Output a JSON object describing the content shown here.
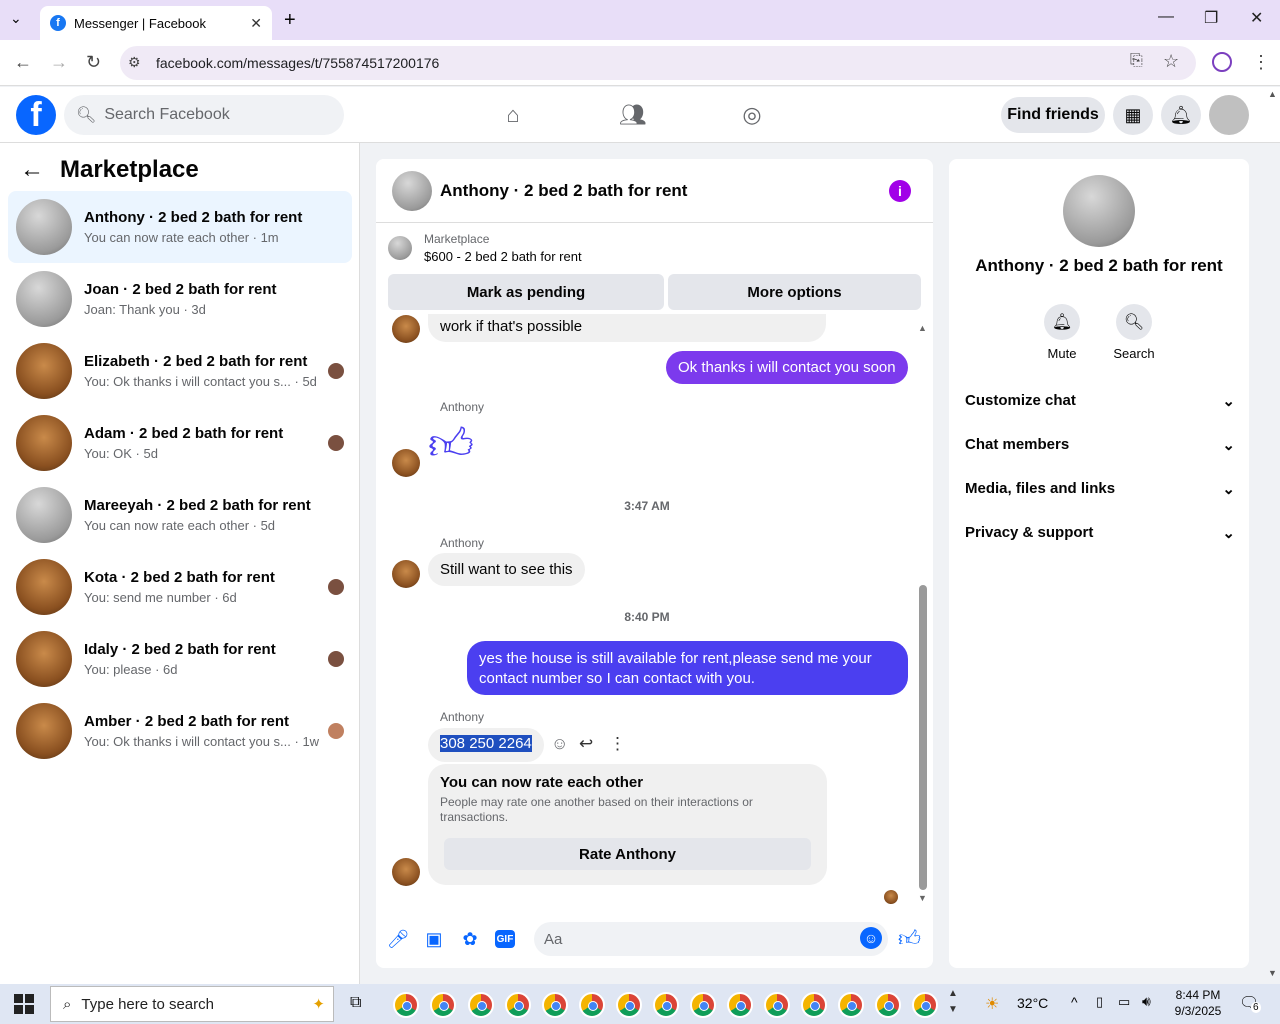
{
  "browser": {
    "tab_title": "Messenger | Facebook",
    "url": "facebook.com/messages/t/755874517200176"
  },
  "fb": {
    "search_placeholder": "Search Facebook",
    "find_friends": "Find friends"
  },
  "sidebar": {
    "title": "Marketplace",
    "conversations": [
      {
        "name": "Anthony · 2 bed 2 bath for rent",
        "preview": "You can now rate each other · 1m",
        "active": true
      },
      {
        "name": "Joan · 2 bed 2 bath for rent",
        "preview": "Joan: Thank you · 3d"
      },
      {
        "name": "Elizabeth · 2 bed 2 bath for rent",
        "preview": "You: Ok thanks i will contact you s... · 5d"
      },
      {
        "name": "Adam · 2 bed 2 bath for rent",
        "preview": "You: OK · 5d"
      },
      {
        "name": "Mareeyah · 2 bed 2 bath for rent",
        "preview": "You can now rate each other · 5d"
      },
      {
        "name": "Kota · 2 bed 2 bath for rent",
        "preview": "You: send me number · 6d"
      },
      {
        "name": "Idaly · 2 bed 2 bath for rent",
        "preview": "You: please · 6d"
      },
      {
        "name": "Amber · 2 bed 2 bath for rent",
        "preview": "You: Ok thanks i will contact you s... · 1w"
      }
    ]
  },
  "chat": {
    "title": "Anthony · 2 bed 2 bath for rent",
    "listing_label": "Marketplace",
    "listing_title": "$600 - 2 bed 2 bath for rent",
    "mark_pending": "Mark as pending",
    "more_options": "More options",
    "msg_partial": "work if that's possible",
    "msg_out1": "Ok thanks i will contact you soon",
    "sender": "Anthony",
    "time1": "3:47 AM",
    "msg_in2": "Still want to see this",
    "time2": "8:40 PM",
    "msg_out2": "yes the house is still available for rent,please send me your contact number so I can contact with you.",
    "msg_phone": "308 250 2264",
    "rate_title": "You can now rate each other",
    "rate_body": "People may rate one another based on their interactions or transactions.",
    "rate_button": "Rate Anthony",
    "compose_placeholder": "Aa"
  },
  "details": {
    "name": "Anthony · 2 bed 2 bath for rent",
    "mute": "Mute",
    "search": "Search",
    "sections": [
      "Customize chat",
      "Chat members",
      "Media, files and links",
      "Privacy & support"
    ]
  },
  "taskbar": {
    "search_placeholder": "Type here to search",
    "temp": "32°C",
    "time": "8:44 PM",
    "date": "9/3/2025",
    "notif_count": "6"
  }
}
